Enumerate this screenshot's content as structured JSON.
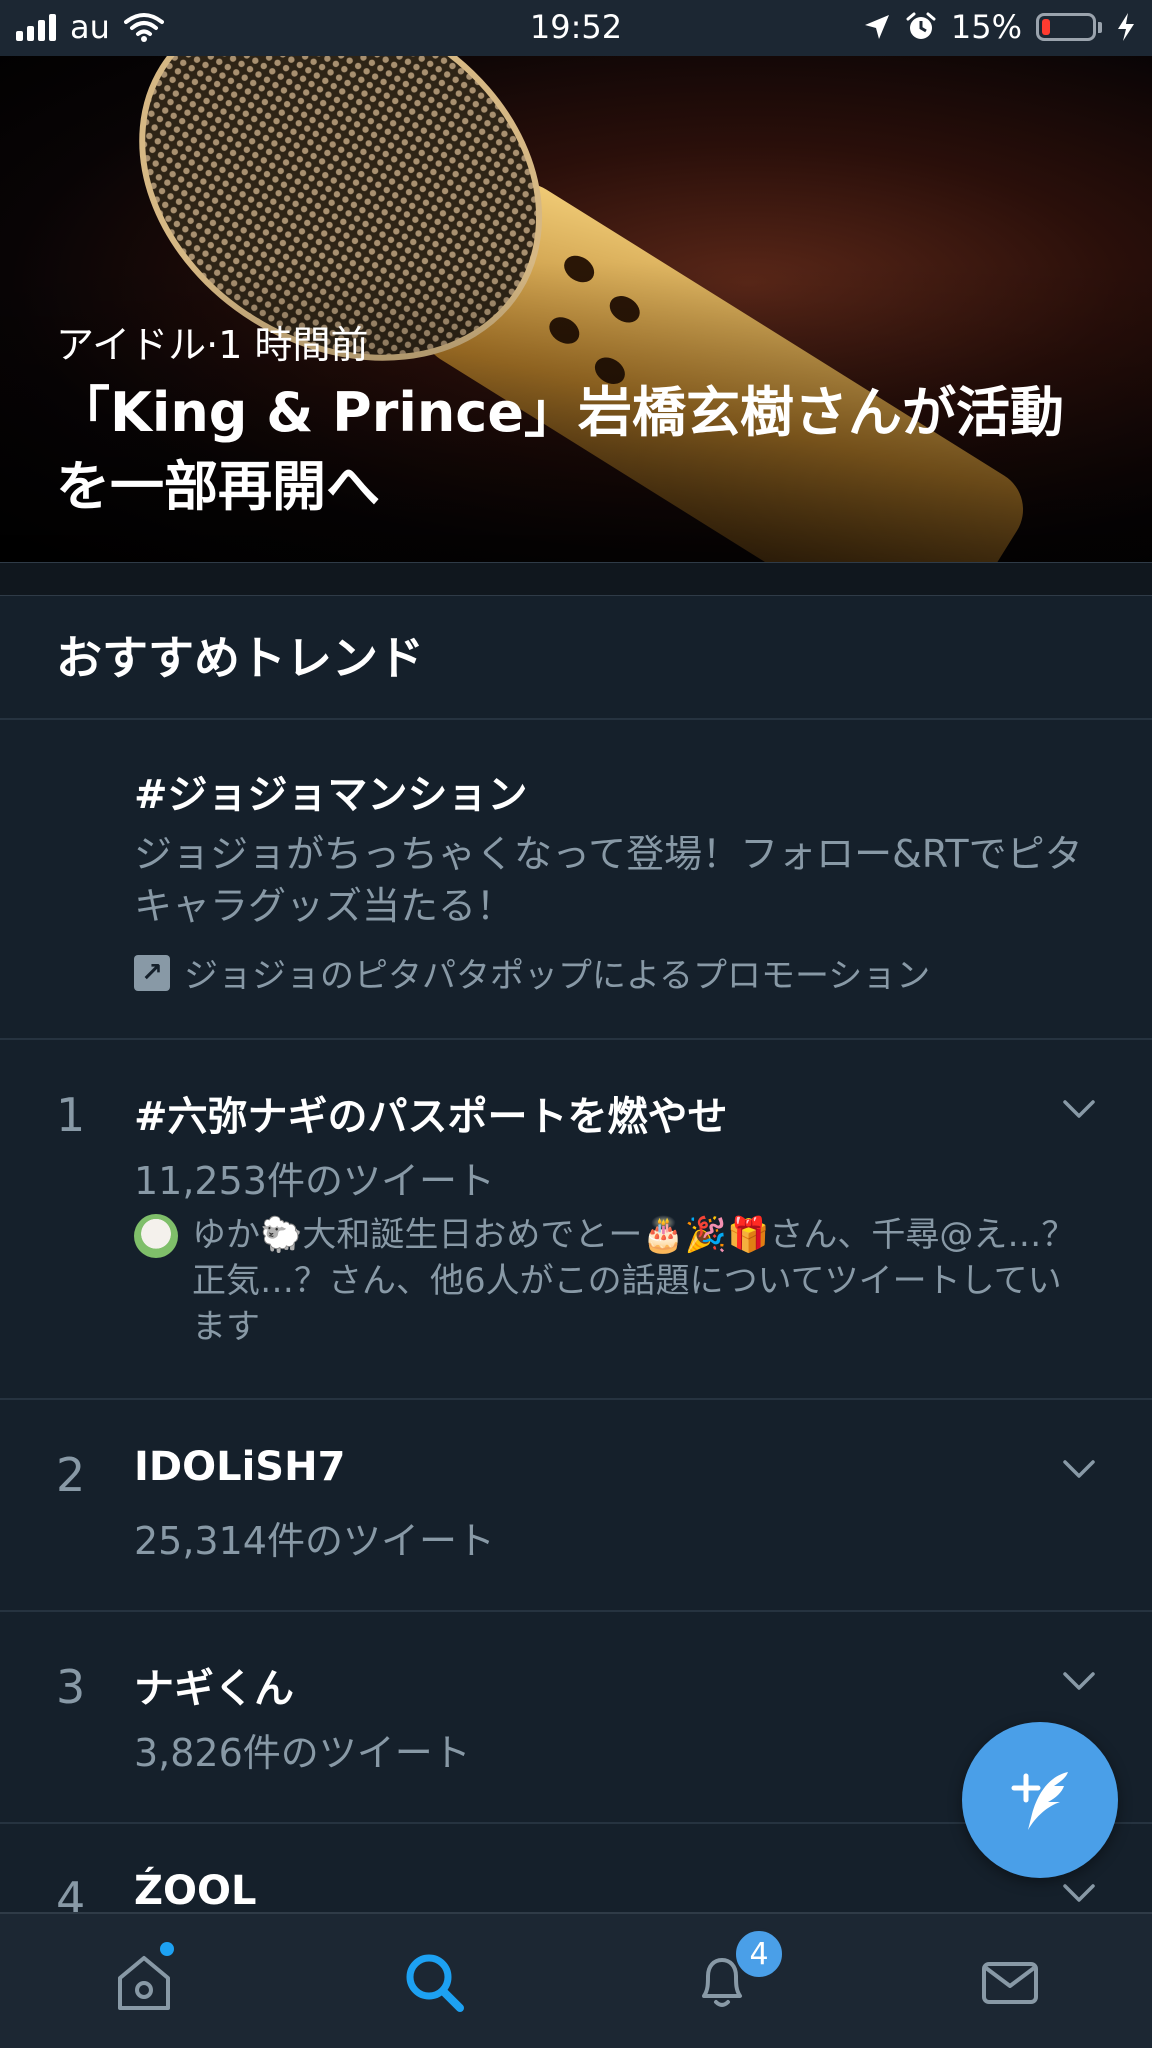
{
  "status": {
    "carrier": "au",
    "time": "19:52",
    "battery_percent": "15%",
    "battery_level": 0.15,
    "battery_color": "#ff3b30",
    "icons": [
      "signal-bars-icon",
      "wifi-icon",
      "location-arrow-icon",
      "alarm-clock-icon",
      "battery-icon",
      "charging-bolt-icon"
    ]
  },
  "hero": {
    "category": "アイドル",
    "separator": "·",
    "time_ago": "1 時間前",
    "headline": "「King & Prince」岩橋玄樹さんが活動を一部再開へ"
  },
  "trends_section": {
    "title": "おすすめトレンド"
  },
  "promoted": {
    "hashtag": "#ジョジョマンション",
    "description": "ジョジョがちっちゃくなって登場！フォロー&RTでピタキャラグッズ当たる！",
    "promoted_by": "ジョジョのピタパタポップによるプロモーション"
  },
  "trends": [
    {
      "rank": "1",
      "name": "#六弥ナギのパスポートを燃やせ",
      "count": "11,253件のツイート",
      "context": "ゆか🐑大和誕生日おめでとー🎂🎉🎁さん、千尋@え…？正気…？さん、他6人がこの話題についてツイートしています"
    },
    {
      "rank": "2",
      "name": "IDOLiSH7",
      "count": "25,314件のツイート"
    },
    {
      "rank": "3",
      "name": "ナギくん",
      "count": "3,826件のツイート"
    },
    {
      "rank": "4",
      "name": "ŹOOL"
    }
  ],
  "tabbar": {
    "items": [
      "home-icon",
      "search-icon",
      "notifications-icon",
      "messages-icon"
    ],
    "active": "search-icon",
    "notification_badge": "4",
    "accent_color": "#1da1f2"
  },
  "fab": {
    "icon": "compose-tweet-icon"
  }
}
